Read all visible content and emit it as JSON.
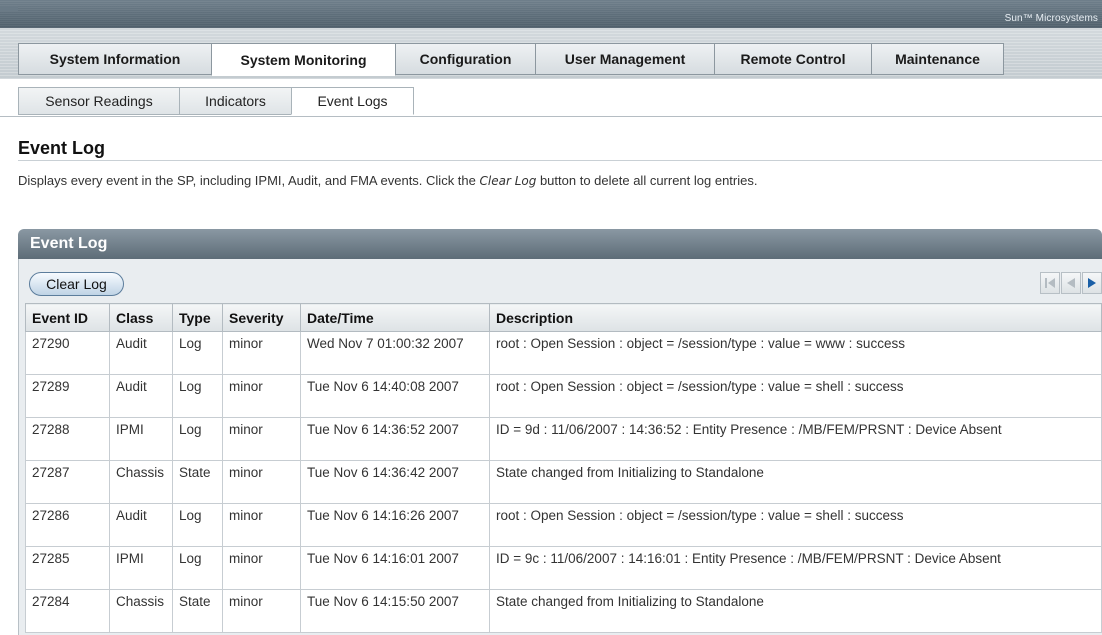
{
  "brand": "Sun™ Microsystems",
  "main_tabs": [
    {
      "label": "System Information"
    },
    {
      "label": "System Monitoring"
    },
    {
      "label": "Configuration"
    },
    {
      "label": "User Management"
    },
    {
      "label": "Remote Control"
    },
    {
      "label": "Maintenance"
    }
  ],
  "active_main_tab": "System Monitoring",
  "sub_tabs": [
    {
      "label": "Sensor Readings"
    },
    {
      "label": "Indicators"
    },
    {
      "label": "Event Logs"
    }
  ],
  "active_sub_tab": "Event Logs",
  "page": {
    "title": "Event Log",
    "description_before": "Displays every event in the SP, including IPMI, Audit, and FMA events. Click the ",
    "description_emph": "Clear Log",
    "description_after": " button to delete all current log entries."
  },
  "panel": {
    "title": "Event Log",
    "clear_button": "Clear Log",
    "pager_icons": [
      "first-page-icon",
      "previous-page-icon",
      "next-page-icon"
    ]
  },
  "table": {
    "columns": [
      "Event ID",
      "Class",
      "Type",
      "Severity",
      "Date/Time",
      "Description"
    ],
    "rows": [
      [
        "27290",
        "Audit",
        "Log",
        "minor",
        "Wed Nov 7 01:00:32 2007",
        "root : Open Session : object = /session/type : value = www : success"
      ],
      [
        "27289",
        "Audit",
        "Log",
        "minor",
        "Tue Nov 6 14:40:08 2007",
        "root : Open Session : object = /session/type : value = shell : success"
      ],
      [
        "27288",
        "IPMI",
        "Log",
        "minor",
        "Tue Nov 6 14:36:52 2007",
        "ID = 9d : 11/06/2007 : 14:36:52 : Entity Presence : /MB/FEM/PRSNT : Device Absent"
      ],
      [
        "27287",
        "Chassis",
        "State",
        "minor",
        "Tue Nov 6 14:36:42 2007",
        "State changed from Initializing to Standalone"
      ],
      [
        "27286",
        "Audit",
        "Log",
        "minor",
        "Tue Nov 6 14:16:26 2007",
        "root : Open Session : object = /session/type : value = shell : success"
      ],
      [
        "27285",
        "IPMI",
        "Log",
        "minor",
        "Tue Nov 6 14:16:01 2007",
        "ID = 9c : 11/06/2007 : 14:16:01 : Entity Presence : /MB/FEM/PRSNT : Device Absent"
      ],
      [
        "27284",
        "Chassis",
        "State",
        "minor",
        "Tue Nov 6 14:15:50 2007",
        "State changed from Initializing to Standalone"
      ]
    ]
  },
  "colors": {
    "header_bar": "#5d6c77",
    "accent_button": "#bfd3e5",
    "pager_active": "#1a5fa6",
    "pager_disabled": "#b4bcc2"
  }
}
